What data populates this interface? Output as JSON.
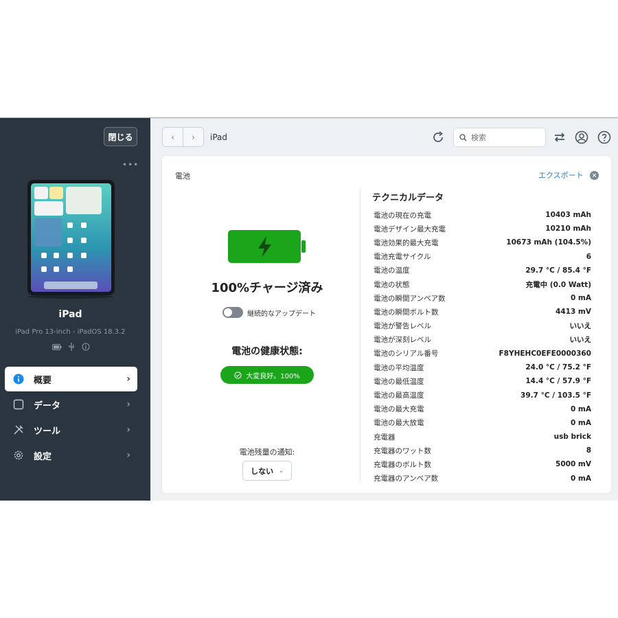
{
  "sidebar": {
    "close_label": "閉じる",
    "more_label": "•••",
    "device_name": "iPad",
    "device_subtitle": "iPad Pro 13-inch - iPadOS 18.3.2",
    "nav": [
      {
        "label": "概要",
        "icon": "info-icon"
      },
      {
        "label": "データ",
        "icon": "square-icon"
      },
      {
        "label": "ツール",
        "icon": "tools-icon"
      },
      {
        "label": "設定",
        "icon": "gear-icon"
      }
    ]
  },
  "topbar": {
    "back_glyph": "‹",
    "forward_glyph": "›",
    "breadcrumb": "iPad",
    "search_placeholder": "検索"
  },
  "card": {
    "title": "電池",
    "export_label": "エクスポート",
    "charged_text": "100%チャージ済み",
    "toggle_label": "継続的なアップデート",
    "health_title": "電池の健康状態:",
    "health_badge": "大変良好。100%",
    "notify_label": "電池残量の通知:",
    "notify_value": "しない",
    "battery_color": "#1aa51a",
    "tech_title": "テクニカルデータ",
    "tech_rows": [
      {
        "k": "電池の現在の充電",
        "v": "10403 mAh"
      },
      {
        "k": "電池デザイン最大充電",
        "v": "10210 mAh"
      },
      {
        "k": "電池効果的最大充電",
        "v": "10673 mAh (104.5%)"
      },
      {
        "k": "電池充電サイクル",
        "v": "6"
      },
      {
        "k": "電池の温度",
        "v": "29.7 °C / 85.4 °F"
      },
      {
        "k": "電池の状態",
        "v": "充電中 (0.0 Watt)"
      },
      {
        "k": "電池の瞬間アンペア数",
        "v": "0 mA"
      },
      {
        "k": "電池の瞬間ボルト数",
        "v": "4413 mV"
      },
      {
        "k": "電池が警告レベル",
        "v": "いいえ"
      },
      {
        "k": "電池が深刻レベル",
        "v": "いいえ"
      },
      {
        "k": "電池のシリアル番号",
        "v": "F8YHEHC0EFE0000360"
      },
      {
        "k": "電池の平均温度",
        "v": "24.0 °C / 75.2 °F"
      },
      {
        "k": "電池の最低温度",
        "v": "14.4 °C / 57.9 °F"
      },
      {
        "k": "電池の最高温度",
        "v": "39.7 °C / 103.5 °F"
      },
      {
        "k": "電池の最大充電",
        "v": "0 mA"
      },
      {
        "k": "電池の最大放電",
        "v": "0 mA"
      },
      {
        "k": "充電器",
        "v": "usb brick"
      },
      {
        "k": "充電器のワット数",
        "v": "8"
      },
      {
        "k": "充電器のボルト数",
        "v": "5000 mV"
      },
      {
        "k": "充電器のアンペア数",
        "v": "0 mA"
      }
    ]
  }
}
